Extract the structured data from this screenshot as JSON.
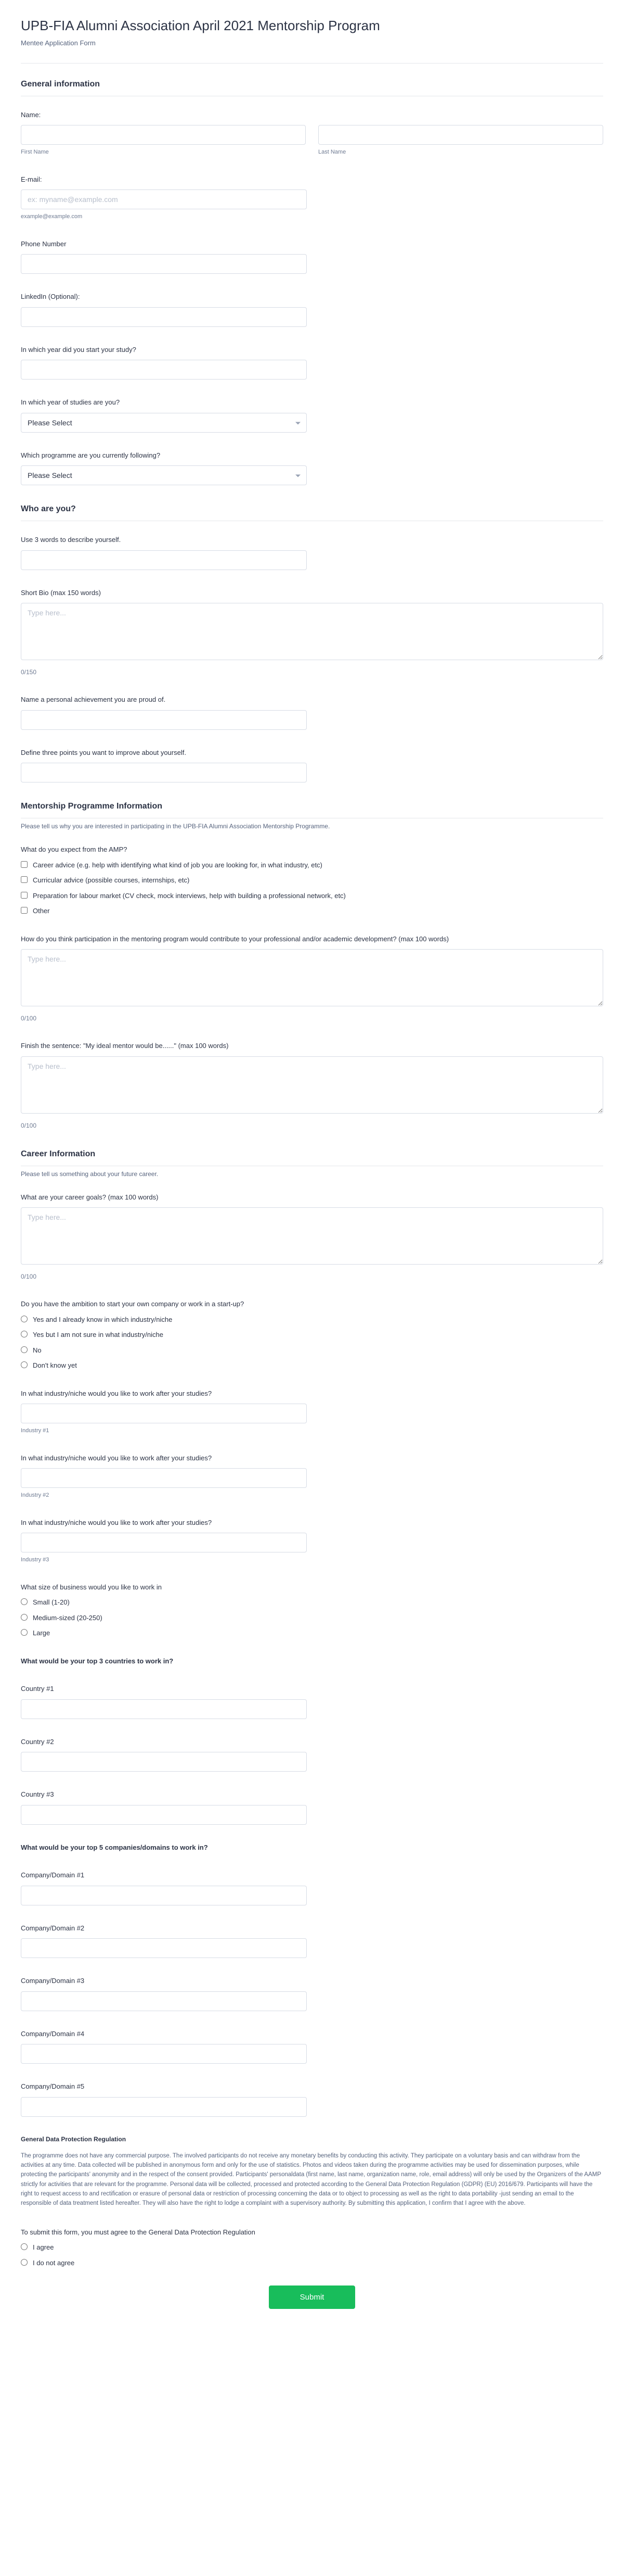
{
  "header": {
    "title": "UPB-FIA Alumni Association April 2021 Mentorship Program",
    "subtitle": "Mentee Application Form"
  },
  "sections": {
    "general": {
      "heading": "General information"
    },
    "who": {
      "heading": "Who are you?"
    },
    "mentorship": {
      "heading": "Mentorship Programme Information",
      "desc": "Please tell us why you are interested in participating in the UPB-FIA Alumni Association Mentorship Programme."
    },
    "career": {
      "heading": "Career Information",
      "desc": "Please tell us something about your future career."
    }
  },
  "labels": {
    "name": "Name:",
    "firstName": "First Name",
    "lastName": "Last Name",
    "email": "E-mail:",
    "emailPlaceholder": "ex: myname@example.com",
    "emailSub": "example@example.com",
    "phone": "Phone Number",
    "linkedin": "LinkedIn (Optional):",
    "startYear": "In which year did you start your study?",
    "studyYear": "In which year of studies are you?",
    "programme": "Which programme are you currently following?",
    "pleaseSelect": "Please Select",
    "threeWords": "Use 3 words to describe yourself.",
    "shortBio": "Short Bio (max 150 words)",
    "typeHere": "Type here...",
    "counter150": "0/150",
    "counter100": "0/100",
    "achievement": "Name a personal achievement you are proud of.",
    "improve": "Define three points you want to improve about yourself.",
    "expectAMP": "What do you expect from the AMP?",
    "contribute": "How do you think participation in the mentoring program would contribute to your professional and/or academic development? (max 100 words)",
    "idealMentor": "Finish the sentence: \"My ideal mentor would be......\" (max 100 words)",
    "careerGoals": "What are your career goals? (max 100 words)",
    "startup": "Do you have the ambition to start your own company or work in a start-up?",
    "industryQ": "In what industry/niche would you like to work after your studies?",
    "industry1": "Industry #1",
    "industry2": "Industry #2",
    "industry3": "Industry #3",
    "bizSize": "What size of business would you like to work in",
    "top3Countries": "What would be your top 3 countries to work in?",
    "country1": "Country #1",
    "country2": "Country #2",
    "country3": "Country #3",
    "top5Companies": "What would be your top 5 companies/domains to work in?",
    "company1": "Company/Domain #1",
    "company2": "Company/Domain #2",
    "company3": "Company/Domain #3",
    "company4": "Company/Domain #4",
    "company5": "Company/Domain #5",
    "gdprHeading": "General Data Protection Regulation",
    "gdprText": "The programme does not have any commercial purpose. The involved participants do not receive any monetary benefits by conducting this activity. They participate on a voluntary basis and can withdraw from the activities at any time. Data collected will be published in anonymous form and only for the use of statistics. Photos and videos taken during the programme activities may be used for dissemination purposes, while protecting the participants' anonymity and in the respect of the consent provided. Participants' personaldata (first name, last name, organization name, role, email address) will only be used by the Organizers of the AAMP strictly for activities that are relevant for the programme. Personal data will be collected, processed and protected according to the General Data Protection Regulation (GDPR) (EU) 2016/679. Participants will have the right to request access to and rectification or erasure of personal data or restriction of processing concerning the data or to object to processing as well as the right to data portability -just sending an email to the responsible of data treatment listed hereafter. They will also have the right to lodge a complaint with a supervisory authority. By submitting this application, I confirm that I agree with the above.",
    "gdprAgreeQ": "To submit this form, you must agree to the General Data Protection Regulation",
    "submit": "Submit"
  },
  "options": {
    "amp": [
      "Career advice (e.g. help with identifying what kind of job you are looking for, in what industry, etc)",
      "Curricular advice (possible courses, internships, etc)",
      "Preparation for labour market (CV check, mock interviews, help with building a professional network, etc)",
      "Other"
    ],
    "startup": [
      "Yes and I already know in which industry/niche",
      "Yes but I am not sure in what industry/niche",
      "No",
      "Don't know yet"
    ],
    "bizSize": [
      "Small (1-20)",
      "Medium-sized (20-250)",
      "Large"
    ],
    "gdpr": [
      "I agree",
      "I do not agree"
    ]
  }
}
